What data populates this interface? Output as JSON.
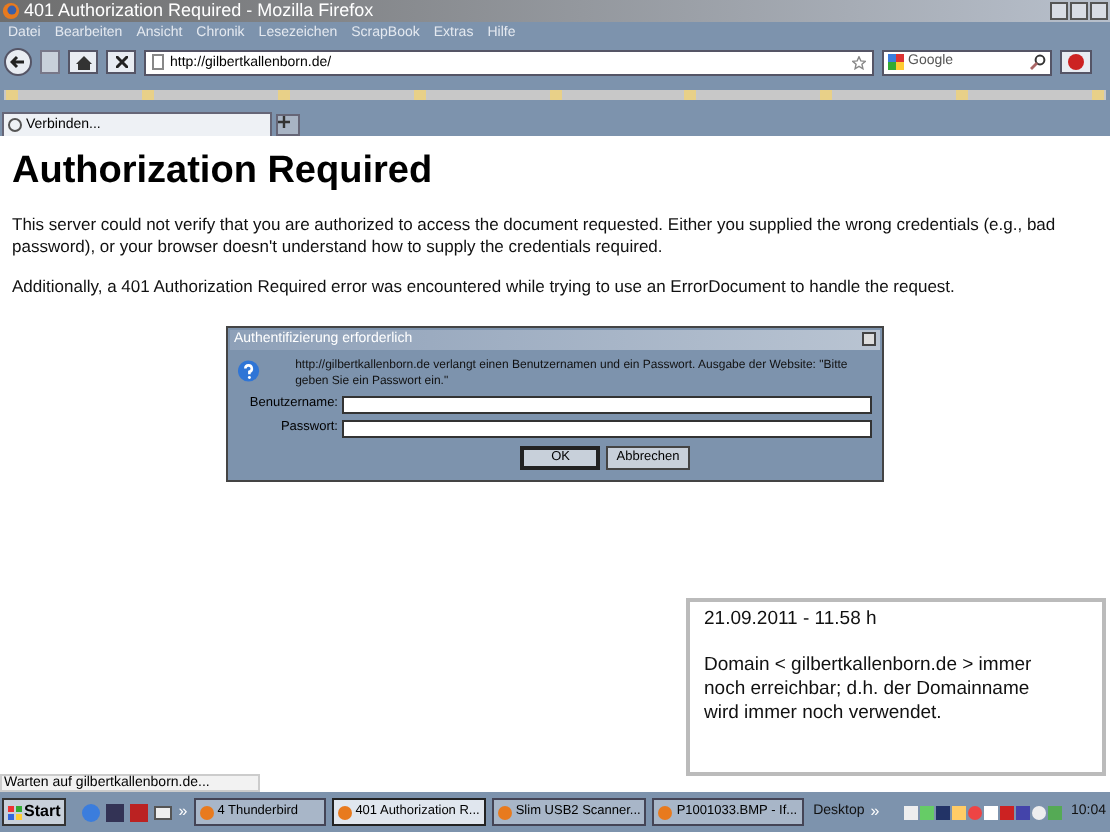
{
  "window": {
    "title": "401 Authorization Required - Mozilla Firefox"
  },
  "menu": [
    "Datei",
    "Bearbeiten",
    "Ansicht",
    "Chronik",
    "Lesezeichen",
    "ScrapBook",
    "Extras",
    "Hilfe"
  ],
  "address_bar": {
    "value": "http://gilbertkallenborn.de/"
  },
  "search": {
    "placeholder": "Google"
  },
  "tabs": [
    {
      "label": "Verbinden...",
      "selected": true
    }
  ],
  "page": {
    "heading": "Authorization Required",
    "paragraphs": [
      "This server could not verify that you are authorized to access the document requested. Either you supplied the wrong credentials (e.g., bad password), or your browser doesn't understand how to supply the credentials required.",
      "Additionally, a 401 Authorization Required error was encountered while trying to use an ErrorDocument to handle the request."
    ]
  },
  "dialog": {
    "title": "Authentifizierung erforderlich",
    "message": "http://gilbertkallenborn.de verlangt einen Benutzernamen und ein Passwort. Ausgabe der Website: \"Bitte geben Sie ein Passwort ein.\"",
    "fields": [
      {
        "label": "Benutzername:"
      },
      {
        "label": "Passwort:"
      }
    ],
    "buttons": [
      {
        "label": "OK",
        "default": true
      },
      {
        "label": "Abbrechen",
        "default": false
      }
    ]
  },
  "note": {
    "lines": [
      "21.09.2011  -  11.58 h",
      "Domain < gilbertkallenborn.de > immer noch erreichbar; d.h. der Domainname wird immer noch verwendet."
    ]
  },
  "status_bar": "Warten auf gilbertkallenborn.de...",
  "taskbar": {
    "start": "Start",
    "chevron": "»",
    "tasks": [
      {
        "label": "4 Thunderbird",
        "selected": false
      },
      {
        "label": "401 Authorization R...",
        "selected": true
      },
      {
        "label": "Slim USB2 Scanner...",
        "selected": false
      },
      {
        "label": "P1001033.BMP - If...",
        "selected": false
      }
    ],
    "desktop": "Desktop",
    "desktop_chevron": "»",
    "clock": "10:04"
  }
}
